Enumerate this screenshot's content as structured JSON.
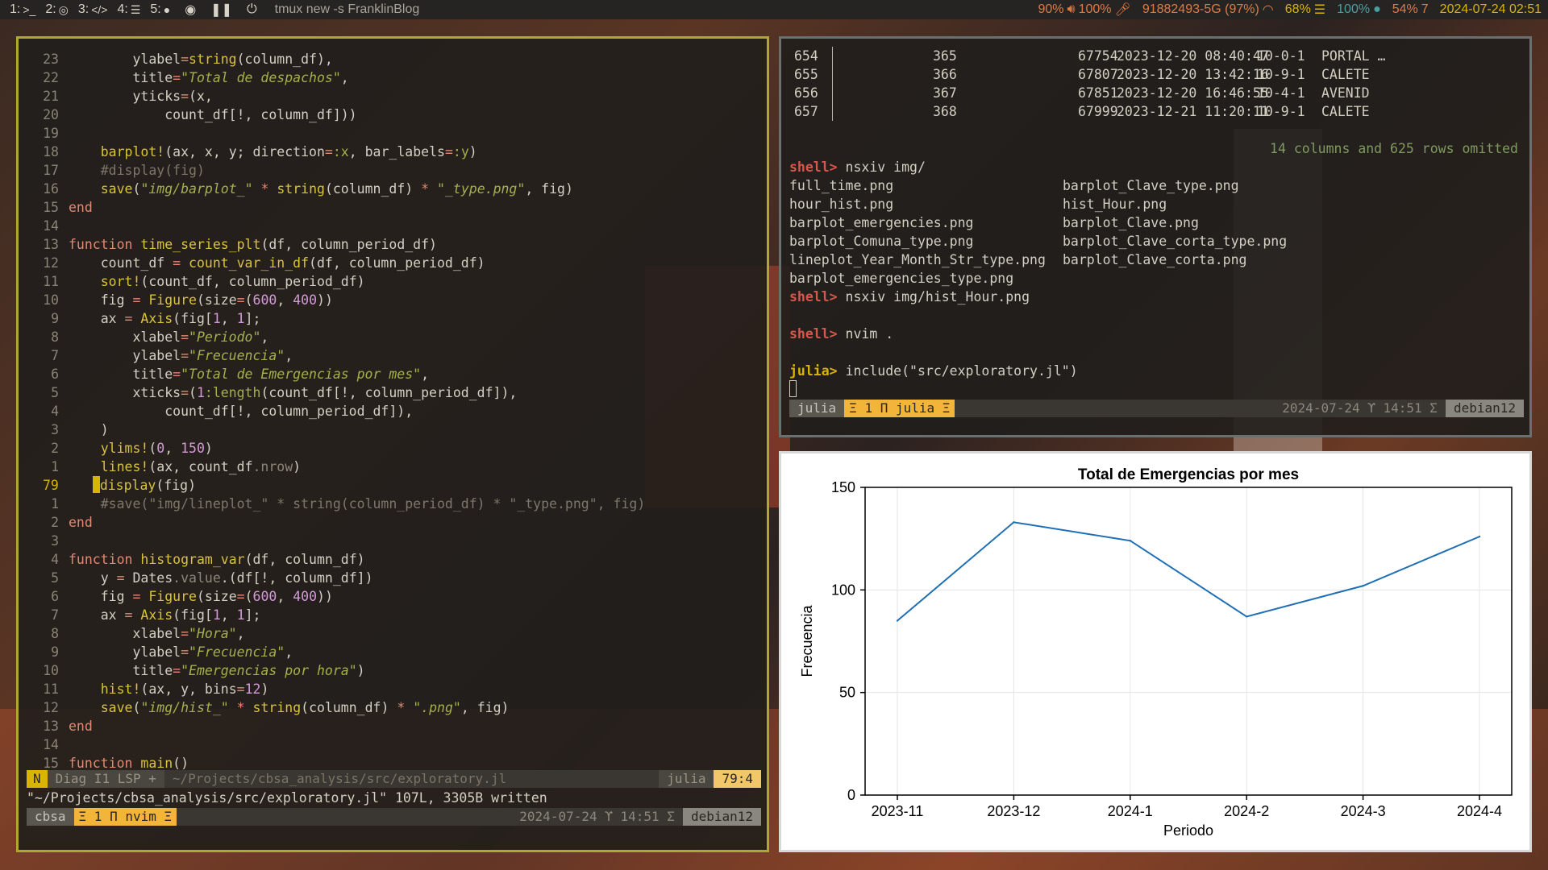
{
  "topbar": {
    "workspaces": [
      {
        "num": "1:",
        "icon": ">_",
        "icon_name": "terminal-icon"
      },
      {
        "num": "2:",
        "icon": "◎",
        "icon_name": "browser-icon"
      },
      {
        "num": "3:",
        "icon": "</>",
        "icon_name": "code-icon"
      },
      {
        "num": "4:",
        "icon": "☰",
        "icon_name": "notes-icon"
      },
      {
        "num": "5:",
        "icon": "●",
        "icon_name": "chat-icon"
      }
    ],
    "extra_icons": [
      "eye-off-icon",
      "pause-icon",
      "power-icon"
    ],
    "title": "tmux new -s FranklinBlog",
    "status": {
      "volume": "90%",
      "mic": "100%",
      "wifi": "91882493-5G (97%)",
      "battery": "68%",
      "brightness": "100%",
      "cpu": "54%",
      "cpu_suffix": "7",
      "datetime": "2024-07-24 02:51"
    },
    "colors": {
      "volume": "#e07a45",
      "wifi": "#e07a45",
      "battery": "#d9b400",
      "brightness": "#4aa0a0",
      "cpu": "#e07a45",
      "datetime": "#d9b400"
    }
  },
  "nvim": {
    "lines": [
      {
        "ln": "23",
        "code": "        ylabel=string(column_df),"
      },
      {
        "ln": "22",
        "code": "        title=\"Total de despachos\","
      },
      {
        "ln": "21",
        "code": "        yticks=(x,"
      },
      {
        "ln": "20",
        "code": "            count_df[!, column_df]))"
      },
      {
        "ln": "19",
        "code": ""
      },
      {
        "ln": "18",
        "code": "    barplot!(ax, x, y; direction=:x, bar_labels=:y)"
      },
      {
        "ln": "17",
        "code": "    #display(fig)"
      },
      {
        "ln": "16",
        "code": "    save(\"img/barplot_\" * string(column_df) * \"_type.png\", fig)"
      },
      {
        "ln": "15",
        "code": "end"
      },
      {
        "ln": "14",
        "code": ""
      },
      {
        "ln": "13",
        "code": "function time_series_plt(df, column_period_df)"
      },
      {
        "ln": "12",
        "code": "    count_df = count_var_in_df(df, column_period_df)"
      },
      {
        "ln": "11",
        "code": "    sort!(count_df, column_period_df)"
      },
      {
        "ln": "10",
        "code": "    fig = Figure(size=(600, 400))"
      },
      {
        "ln": "9",
        "code": "    ax = Axis(fig[1, 1];"
      },
      {
        "ln": "8",
        "code": "        xlabel=\"Periodo\","
      },
      {
        "ln": "7",
        "code": "        ylabel=\"Frecuencia\","
      },
      {
        "ln": "6",
        "code": "        title=\"Total de Emergencias por mes\","
      },
      {
        "ln": "5",
        "code": "        xticks=(1:length(count_df[!, column_period_df]),"
      },
      {
        "ln": "4",
        "code": "            count_df[!, column_period_df]),"
      },
      {
        "ln": "3",
        "code": "    )"
      },
      {
        "ln": "2",
        "code": "    ylims!(0, 150)"
      },
      {
        "ln": "1",
        "code": "    lines!(ax, count_df.nrow)"
      },
      {
        "ln": "79",
        "code": "    display(fig)",
        "current": true
      },
      {
        "ln": "1",
        "code": "    #save(\"img/lineplot_\" * string(column_period_df) * \"_type.png\", fig)"
      },
      {
        "ln": "2",
        "code": "end"
      },
      {
        "ln": "3",
        "code": ""
      },
      {
        "ln": "4",
        "code": "function histogram_var(df, column_df)"
      },
      {
        "ln": "5",
        "code": "    y = Dates.value.(df[!, column_df])"
      },
      {
        "ln": "6",
        "code": "    fig = Figure(size=(600, 400))"
      },
      {
        "ln": "7",
        "code": "    ax = Axis(fig[1, 1];"
      },
      {
        "ln": "8",
        "code": "        xlabel=\"Hora\","
      },
      {
        "ln": "9",
        "code": "        ylabel=\"Frecuencia\","
      },
      {
        "ln": "10",
        "code": "        title=\"Emergencias por hora\")"
      },
      {
        "ln": "11",
        "code": "    hist!(ax, y, bins=12)"
      },
      {
        "ln": "12",
        "code": "    save(\"img/hist_\" * string(column_df) * \".png\", fig)"
      },
      {
        "ln": "13",
        "code": "end"
      },
      {
        "ln": "14",
        "code": ""
      },
      {
        "ln": "15",
        "code": "function main()"
      }
    ],
    "status": {
      "mode": "N",
      "diag": "Diag I1 LSP +",
      "file": "~/Projects/cbsa_analysis/src/exploratory.jl",
      "filetype": "julia",
      "position": "79:4"
    },
    "message": "\"~/Projects/cbsa_analysis/src/exploratory.jl\" 107L, 3305B written",
    "tmux": {
      "session": "cbsa",
      "window": "Ξ 1 Π nvim Ξ",
      "datetime": "2024-07-24 ϒ 14:51 Σ",
      "host": "debian12"
    }
  },
  "terminal": {
    "table_rows": [
      [
        "654",
        "365",
        "67754",
        "2023-12-20 08:40:47",
        "10-0-1",
        "PORTAL …"
      ],
      [
        "655",
        "366",
        "67807",
        "2023-12-20 13:42:16",
        "10-9-1",
        "CALETE"
      ],
      [
        "656",
        "367",
        "67851",
        "2023-12-20 16:46:55",
        "10-4-1",
        "AVENID"
      ],
      [
        "657",
        "368",
        "67999",
        "2023-12-21 11:20:11",
        "10-9-1",
        "CALETE"
      ]
    ],
    "omitted": "14 columns and 625 rows omitted",
    "cmd1_prompt": "shell>",
    "cmd1": " nsxiv img/",
    "files_col1": [
      "full_time.png",
      "hour_hist.png",
      "barplot_emergencies.png",
      "barplot_Comuna_type.png",
      "lineplot_Year_Month_Str_type.png",
      "barplot_emergencies_type.png"
    ],
    "files_col2": [
      "barplot_Clave_type.png",
      "hist_Hour.png",
      "barplot_Clave.png",
      "barplot_Clave_corta_type.png",
      "barplot_Clave_corta.png"
    ],
    "cmd2_prompt": "shell>",
    "cmd2": " nsxiv img/hist_Hour.png",
    "cmd3_prompt": "shell>",
    "cmd3": " nvim .",
    "cmd4_prompt": "julia>",
    "cmd4": " include(\"src/exploratory.jl\")",
    "tmux": {
      "session": "julia",
      "window": "Ξ 1 Π julia Ξ",
      "datetime": "2024-07-24 ϒ 14:51 Σ",
      "host": "debian12"
    }
  },
  "chart_data": {
    "type": "line",
    "title": "Total de Emergencias por mes",
    "xlabel": "Periodo",
    "ylabel": "Frecuencia",
    "categories": [
      "2023-11",
      "2023-12",
      "2024-1",
      "2024-2",
      "2024-3",
      "2024-4"
    ],
    "values": [
      85,
      133,
      124,
      87,
      102,
      126
    ],
    "ylim": [
      0,
      150
    ],
    "yticks": [
      0,
      50,
      100,
      150
    ],
    "grid": true,
    "line_color": "#1f6fb4"
  }
}
